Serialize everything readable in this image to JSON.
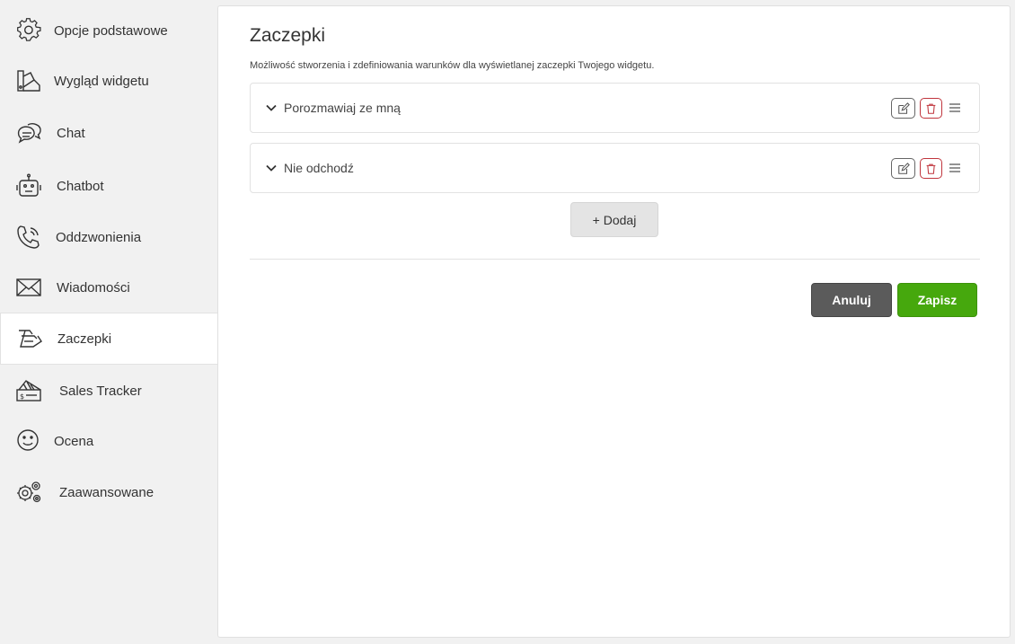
{
  "sidebar": {
    "items": [
      {
        "label": "Opcje podstawowe",
        "icon": "gear-icon"
      },
      {
        "label": "Wygląd widgetu",
        "icon": "palette-icon"
      },
      {
        "label": "Chat",
        "icon": "chat-bubbles-icon"
      },
      {
        "label": "Chatbot",
        "icon": "robot-icon"
      },
      {
        "label": "Oddzwonienia",
        "icon": "phone-callback-icon"
      },
      {
        "label": "Wiadomości",
        "icon": "envelope-icon"
      },
      {
        "label": "Zaczepki",
        "icon": "hand-wave-icon",
        "active": true
      },
      {
        "label": "Sales Tracker",
        "icon": "sales-ticket-icon"
      },
      {
        "label": "Ocena",
        "icon": "smiley-icon"
      },
      {
        "label": "Zaawansowane",
        "icon": "gears-icon"
      }
    ]
  },
  "main": {
    "title": "Zaczepki",
    "subtitle": "Możliwość stworzenia i zdefiniowania warunków dla wyświetlanej zaczepki Twojego widgetu.",
    "hooks": [
      {
        "label": "Porozmawiaj ze mną"
      },
      {
        "label": "Nie odchodź"
      }
    ],
    "add_label": "+ Dodaj",
    "cancel_label": "Anuluj",
    "save_label": "Zapisz"
  },
  "colors": {
    "sidebar_bg": "#f1f1f1",
    "panel_bg": "#ffffff",
    "save": "#46a80d",
    "cancel": "#5b5b5b",
    "delete": "#c0353d"
  }
}
